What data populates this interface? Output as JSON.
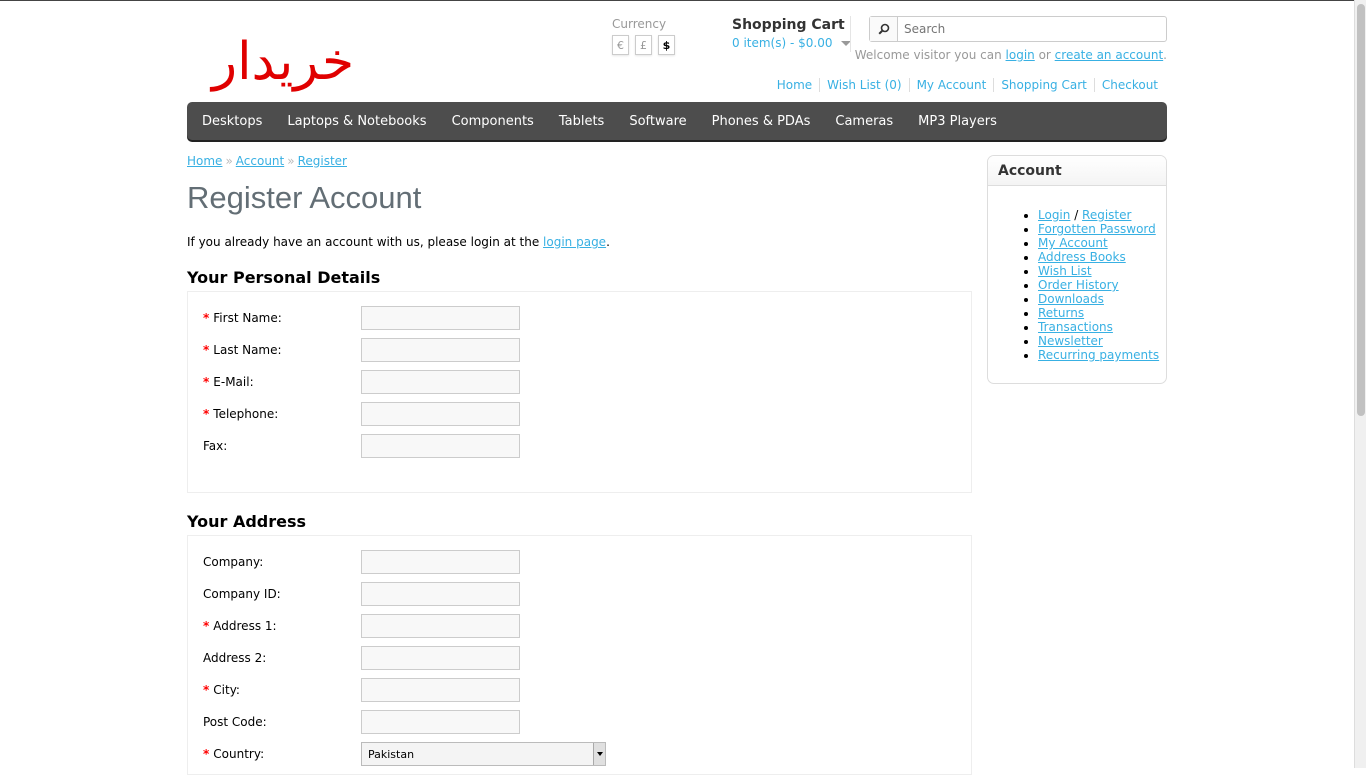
{
  "logo": {
    "text": "خریدار",
    "color": "#e00000"
  },
  "currency": {
    "label": "Currency",
    "options": [
      "€",
      "£",
      "$"
    ],
    "selected": "$"
  },
  "cart": {
    "title": "Shopping Cart",
    "total": "0 item(s) - $0.00"
  },
  "search": {
    "placeholder": "Search"
  },
  "welcome": {
    "prefix": "Welcome visitor you can ",
    "login": "login",
    "or": " or ",
    "create": "create an account",
    "suffix": "."
  },
  "top_links": [
    "Home",
    "Wish List (0)",
    "My Account",
    "Shopping Cart",
    "Checkout"
  ],
  "menu": [
    "Desktops",
    "Laptops & Notebooks",
    "Components",
    "Tablets",
    "Software",
    "Phones & PDAs",
    "Cameras",
    "MP3 Players"
  ],
  "breadcrumb": [
    "Home",
    "Account",
    "Register"
  ],
  "breadcrumb_sep": "»",
  "page_title": "Register Account",
  "intro": {
    "text": "If you already have an account with us, please login at the ",
    "link": "login page",
    "suffix": "."
  },
  "personal": {
    "title": "Your Personal Details",
    "fields": [
      {
        "label": "First Name:",
        "required": true
      },
      {
        "label": "Last Name:",
        "required": true
      },
      {
        "label": "E-Mail:",
        "required": true
      },
      {
        "label": "Telephone:",
        "required": true
      },
      {
        "label": "Fax:",
        "required": false
      }
    ]
  },
  "address": {
    "title": "Your Address",
    "fields": [
      {
        "label": "Company:",
        "required": false
      },
      {
        "label": "Company ID:",
        "required": false
      },
      {
        "label": "Address 1:",
        "required": true
      },
      {
        "label": "Address 2:",
        "required": false
      },
      {
        "label": "City:",
        "required": true
      },
      {
        "label": "Post Code:",
        "required": false
      }
    ],
    "country": {
      "label": "Country:",
      "required": true,
      "value": "Pakistan"
    }
  },
  "required_mark": "*",
  "sidebar": {
    "title": "Account",
    "login": "Login",
    "slash": " / ",
    "register": "Register",
    "items": [
      "Forgotten Password",
      "My Account",
      "Address Books",
      "Wish List",
      "Order History",
      "Downloads",
      "Returns",
      "Transactions",
      "Newsletter",
      "Recurring payments"
    ]
  }
}
